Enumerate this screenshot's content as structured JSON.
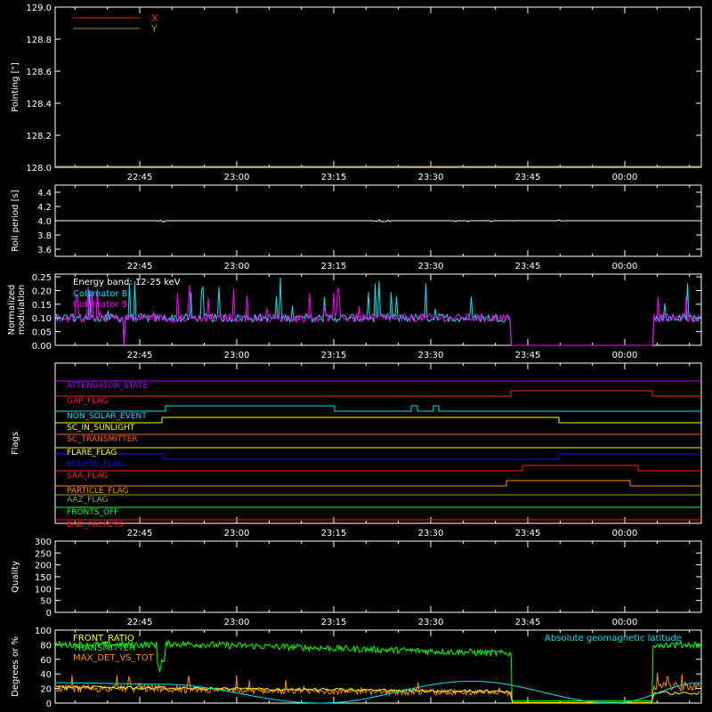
{
  "time_ticks": [
    "22:45",
    "23:00",
    "23:15",
    "23:30",
    "23:45",
    "00:00"
  ],
  "colors": {
    "background": "#000000",
    "axes": "#ffffff",
    "white": "#ffffff",
    "red": "#ff2020",
    "olive": "#a08a1e",
    "cyan": "#00e5ee",
    "magenta": "#ff00ff",
    "green": "#00ff00",
    "orange": "#ff8c00",
    "yellow": "#ffff00",
    "blue": "#1010ff",
    "purple": "#b000ff",
    "violet": "#e020ff",
    "khaki": "#a0a020",
    "lime": "#00ff40"
  },
  "chart_data": [
    {
      "type": "line",
      "ylabel": "Pointing [\"]",
      "ylim": [
        128.0,
        129.0
      ],
      "yticks": [
        "128.0",
        "128.2",
        "128.4",
        "128.6",
        "128.8",
        "129.0"
      ],
      "legend_placement": "top-left",
      "series": [
        {
          "name": "X",
          "color": "#ff2020"
        },
        {
          "name": "Y",
          "color": "#a08a1e"
        }
      ]
    },
    {
      "type": "line",
      "ylabel": "Roll period [s]",
      "ylim": [
        3.5,
        4.5
      ],
      "yticks": [
        "3.6",
        "3.8",
        "4.0",
        "4.2",
        "4.4"
      ],
      "series": [
        {
          "color": "#ffffff",
          "base_value": 4.0
        }
      ]
    },
    {
      "type": "line",
      "ylabel": "Normalized modulation",
      "ylabel_lines": [
        "Normalized",
        "modulation"
      ],
      "ylim": [
        0.0,
        0.26
      ],
      "yticks": [
        "0.00",
        "0.05",
        "0.10",
        "0.15",
        "0.20",
        "0.25"
      ],
      "annotation": "Energy band: 12-25 keV",
      "series": [
        {
          "name": "Collimator 8",
          "color": "#00e5ee",
          "base_value": 0.1
        },
        {
          "name": "Collimator 9",
          "color": "#ff00ff",
          "base_value": 0.1
        }
      ]
    },
    {
      "type": "line",
      "ylabel": "Flags",
      "flags": [
        {
          "name": "ATTENUATOR_STATE",
          "color": "#b000ff"
        },
        {
          "name": "GAP_FLAG",
          "color": "#ff2020"
        },
        {
          "name": "NON_SOLAR_EVENT",
          "color": "#00e5ee"
        },
        {
          "name": "SC_IN_SUNLIGHT",
          "color": "#ffff00"
        },
        {
          "name": "SC_TRANSMITTER",
          "color": "#ff5a1e"
        },
        {
          "name": "FLARE_FLAG",
          "color": "#ffff00"
        },
        {
          "name": "ECLIPSE_FLAG",
          "color": "#1010ff"
        },
        {
          "name": "SAA_FLAG",
          "color": "#ff2020"
        },
        {
          "name": "PARTICLE_FLAG",
          "color": "#ff8c00"
        },
        {
          "name": "AAZ_FLAG",
          "color": "#a0a020"
        },
        {
          "name": "FRONTS_OFF",
          "color": "#00ff40"
        },
        {
          "name": "BAD_PACKETS",
          "color": "#ff2020"
        }
      ]
    },
    {
      "type": "line",
      "ylabel": "Quality",
      "ylim": [
        0,
        300
      ],
      "yticks": [
        "0",
        "50",
        "100",
        "150",
        "200",
        "250",
        "300"
      ]
    },
    {
      "type": "line",
      "ylabel": "Degrees or %",
      "ylim": [
        0,
        100
      ],
      "yticks": [
        "0",
        "20",
        "40",
        "60",
        "80",
        "100"
      ],
      "series": [
        {
          "name": "FRONT_RATIO",
          "color": "#ffff00"
        },
        {
          "name": "TRANSMITTER",
          "color": "#00ff00"
        },
        {
          "name": "MAX_DET_VS_TOT",
          "color": "#ff8c00"
        },
        {
          "name": "Absolute geomagnetic latitude",
          "color": "#00e5ee"
        }
      ]
    }
  ]
}
